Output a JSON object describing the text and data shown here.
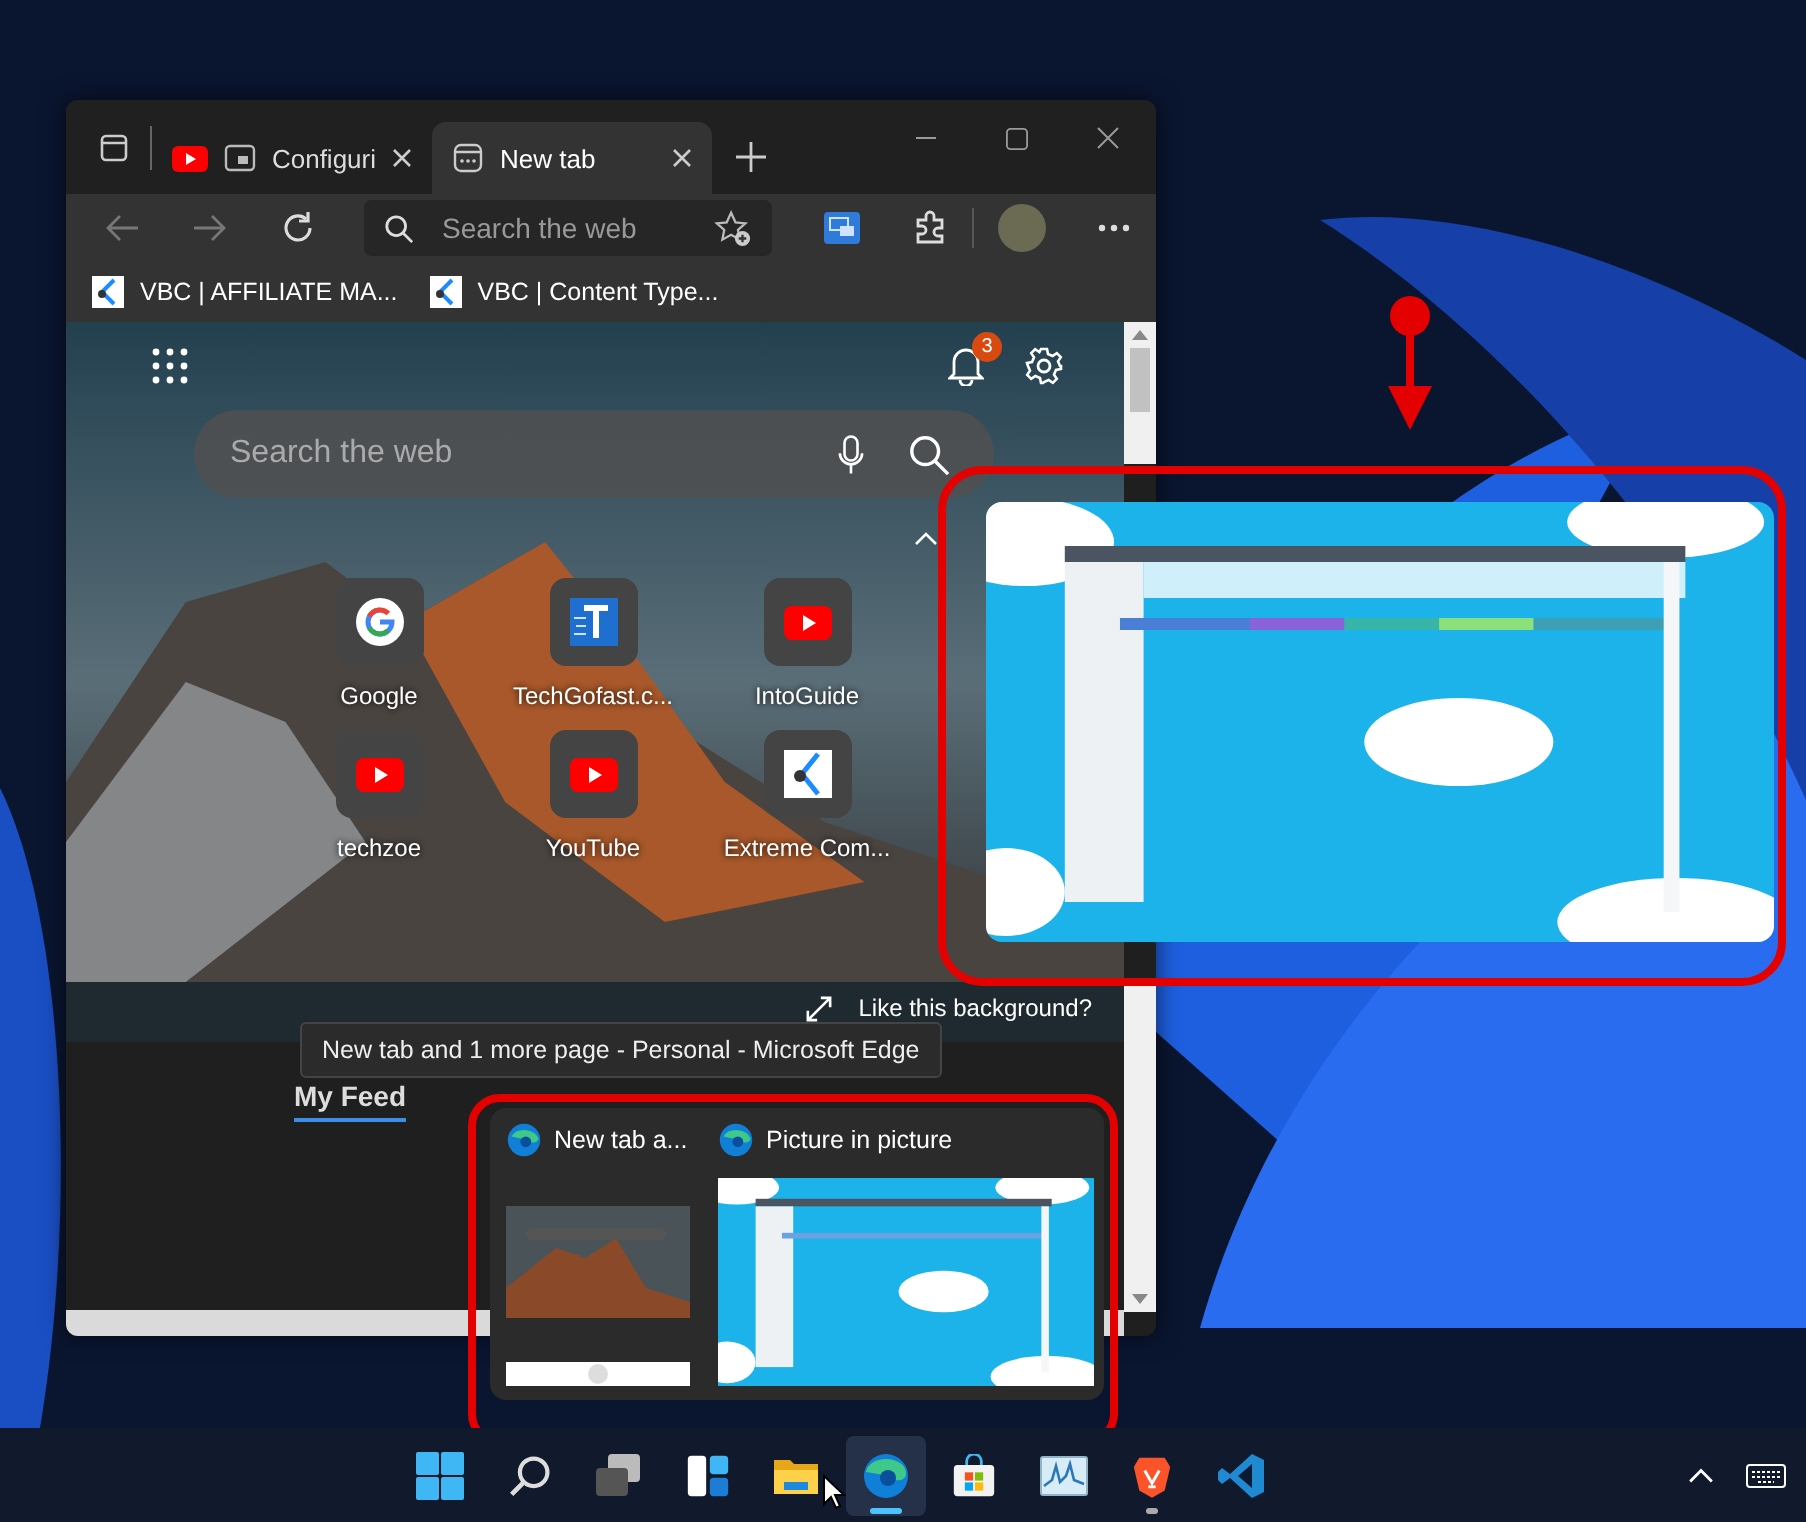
{
  "browser": {
    "tabs": [
      {
        "title": "Configuri",
        "selected": false,
        "kind": "video"
      },
      {
        "title": "New tab",
        "selected": true,
        "kind": "newtab"
      }
    ],
    "address": {
      "placeholder": "Search the web"
    },
    "favorites": [
      "VBC | AFFILIATE MA...",
      "VBC | Content Type..."
    ],
    "new_tab_page": {
      "search_placeholder": "Search the web",
      "notification_count": "3",
      "quick_links": [
        {
          "label": "Google",
          "kind": "google"
        },
        {
          "label": "TechGofast.c...",
          "kind": "techgofast"
        },
        {
          "label": "IntoGuide",
          "kind": "youtube"
        },
        {
          "label": "techzoe",
          "kind": "youtube"
        },
        {
          "label": "YouTube",
          "kind": "youtube"
        },
        {
          "label": "Extreme Com...",
          "kind": "extreme"
        }
      ],
      "background_prompt": "Like this background?",
      "feed_tab": "My Feed"
    }
  },
  "tooltip": "New tab and 1 more page - Personal - Microsoft Edge",
  "thumbnails": [
    {
      "title": "New tab a...",
      "kind": "browser"
    },
    {
      "title": "Picture in picture",
      "kind": "pip"
    }
  ],
  "taskbar": {
    "apps": [
      {
        "kind": "start",
        "active": false,
        "running": false
      },
      {
        "kind": "search",
        "active": false,
        "running": false
      },
      {
        "kind": "taskview",
        "active": false,
        "running": false
      },
      {
        "kind": "widgets",
        "active": false,
        "running": false
      },
      {
        "kind": "explorer",
        "active": false,
        "running": false
      },
      {
        "kind": "edge",
        "active": true,
        "running": true
      },
      {
        "kind": "store",
        "active": false,
        "running": false
      },
      {
        "kind": "monitor",
        "active": false,
        "running": false
      },
      {
        "kind": "brave",
        "active": false,
        "running": true
      },
      {
        "kind": "vscode",
        "active": false,
        "running": false
      }
    ]
  }
}
